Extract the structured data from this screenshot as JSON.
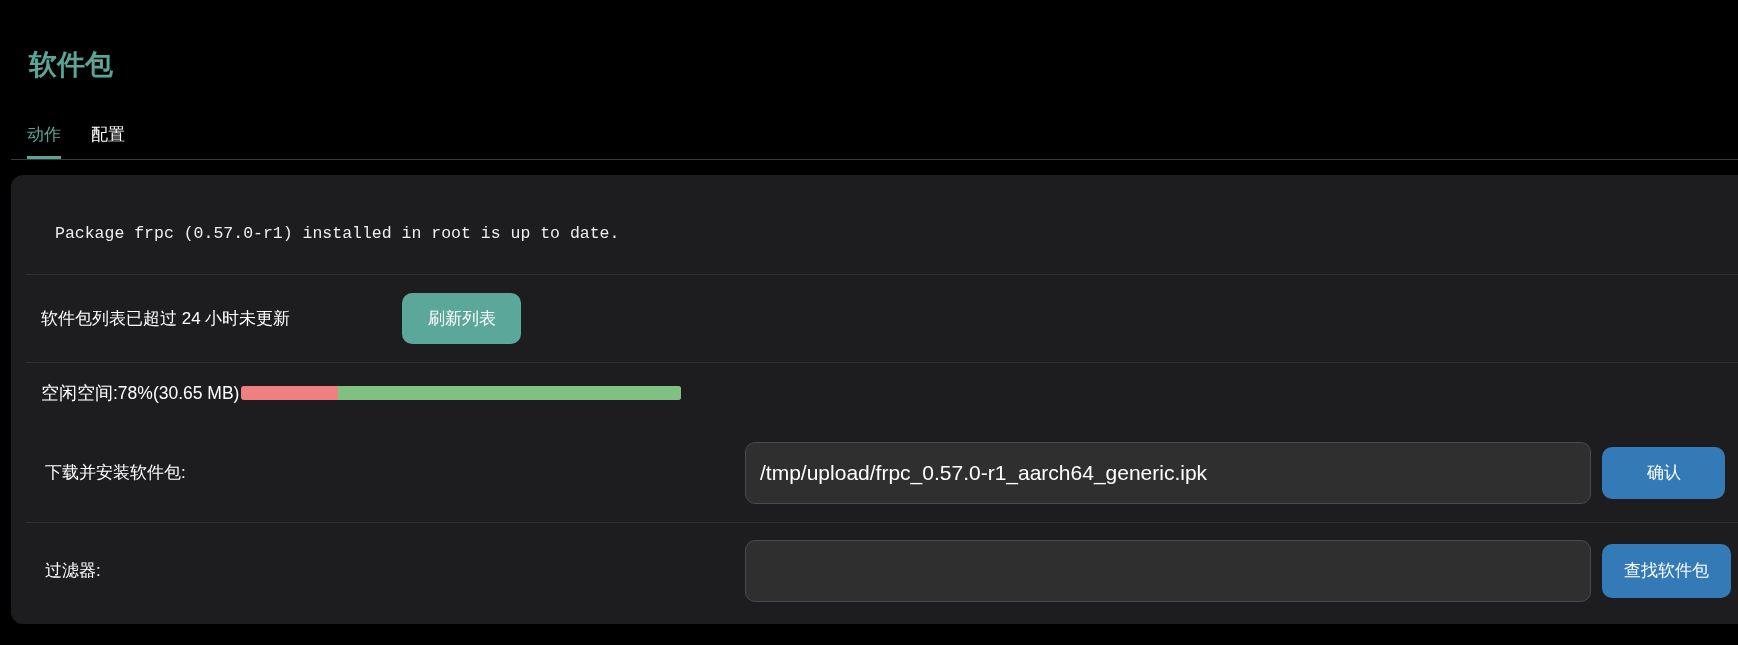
{
  "page": {
    "title": "软件包"
  },
  "tabs": [
    {
      "label": "动作",
      "selected": true
    },
    {
      "label": "配置",
      "selected": false
    }
  ],
  "status_message": "Package frpc (0.57.0-r1) installed in root is up to date.",
  "list_notice": {
    "text": "软件包列表已超过 24 小时未更新",
    "button": "刷新列表"
  },
  "free_space": {
    "label": "空闲空间:78%(30.65 MB)",
    "level": 0.78
  },
  "install": {
    "label": "下载并安装软件包:",
    "value": "/tmp/upload/frpc_0.57.0-r1_aarch64_generic.ipk",
    "button": "确认"
  },
  "filter": {
    "label": "过滤器:",
    "button": "查找软件包"
  }
}
